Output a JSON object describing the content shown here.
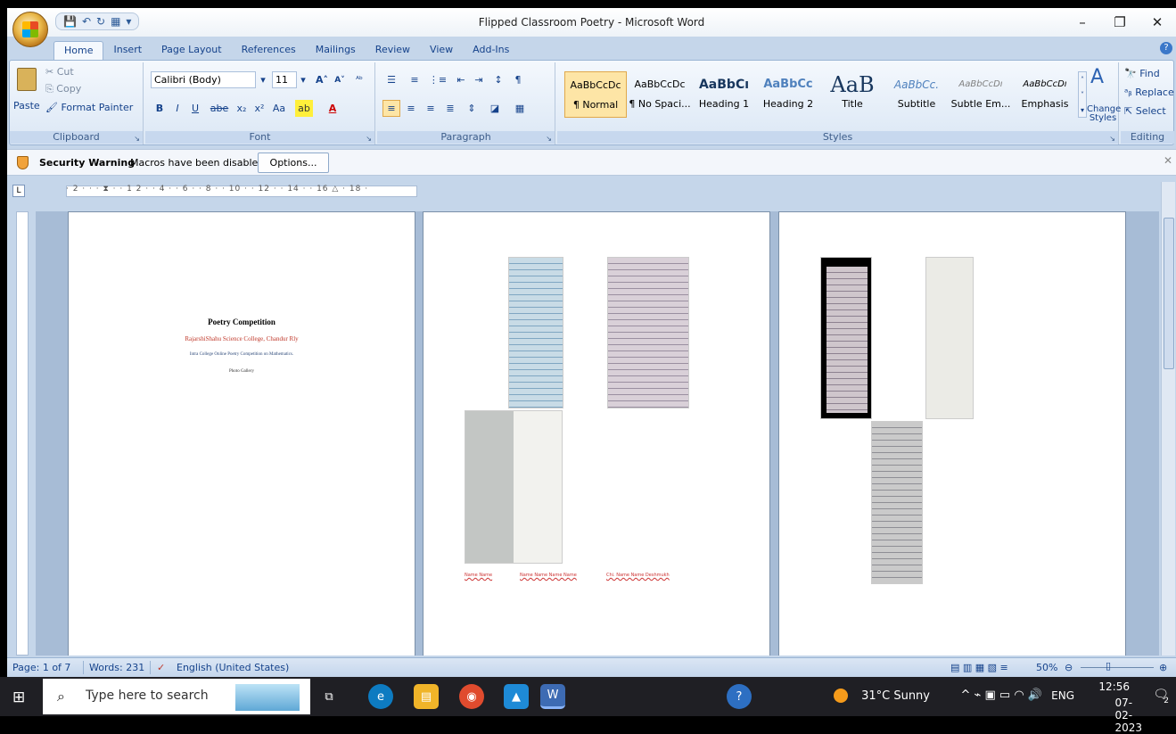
{
  "window": {
    "title": "Flipped Classroom Poetry - Microsoft Word",
    "controls": [
      "–",
      "❐",
      "✕"
    ]
  },
  "tabs": [
    "Home",
    "Insert",
    "Page Layout",
    "References",
    "Mailings",
    "Review",
    "View",
    "Add-Ins"
  ],
  "ribbon": {
    "clipboard": {
      "paste": "Paste",
      "cut": "Cut",
      "copy": "Copy",
      "format_painter": "Format Painter",
      "label": "Clipboard"
    },
    "font": {
      "name": "Calibri (Body)",
      "size": "11",
      "label": "Font"
    },
    "paragraph": {
      "label": "Paragraph"
    },
    "styles": {
      "label": "Styles",
      "items": [
        {
          "preview": "AaBbCcDc",
          "name": "¶ Normal"
        },
        {
          "preview": "AaBbCcDc",
          "name": "¶ No Spaci..."
        },
        {
          "preview": "AaBbCı",
          "name": "Heading 1"
        },
        {
          "preview": "AaBbCc",
          "name": "Heading 2"
        },
        {
          "preview": "AaB",
          "name": "Title"
        },
        {
          "preview": "AaBbCc.",
          "name": "Subtitle"
        },
        {
          "preview": "AaBbCcDı",
          "name": "Subtle Em..."
        },
        {
          "preview": "AaBbCcDı",
          "name": "Emphasis"
        }
      ],
      "change_styles": "Change Styles"
    },
    "editing": {
      "find": "Find",
      "replace": "Replace",
      "select": "Select",
      "label": "Editing"
    }
  },
  "security": {
    "title": "Security Warning",
    "message": "Macros have been disabled.",
    "button": "Options..."
  },
  "document": {
    "page1": {
      "title": "Poetry Competition",
      "college": "RajarshiShahu Science College, Chandur Rly",
      "subtitle": "Intra College Online Poetry Competition on Mathematics.",
      "gallery": "Photo Gallery"
    },
    "page2": {
      "captions": [
        "Name Name",
        "Name Name Name Name",
        "Chi. Name Name Deshmukh"
      ]
    }
  },
  "status": {
    "page": "Page: 1 of 7",
    "words": "Words: 231",
    "language": "English (United States)",
    "zoom": "50%"
  },
  "taskbar": {
    "search_placeholder": "Type here to search",
    "weather": "31°C  Sunny",
    "lang": "ENG",
    "time": "12:56",
    "date": "07-02-2023",
    "notifications": "2"
  }
}
